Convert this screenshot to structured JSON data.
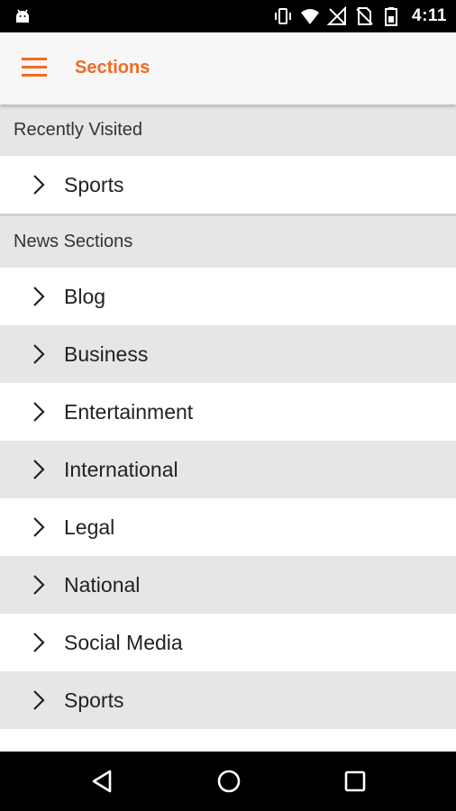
{
  "status_bar": {
    "time": "4:11",
    "icons": [
      "android-icon",
      "vibrate-icon",
      "wifi-icon",
      "no-signal-icon",
      "no-sim-icon",
      "battery-icon"
    ]
  },
  "app_bar": {
    "title": "Sections",
    "accent_color": "#f26a21"
  },
  "recently_visited": {
    "header": "Recently Visited",
    "items": [
      {
        "label": "Sports"
      }
    ]
  },
  "news_sections": {
    "header": "News Sections",
    "items": [
      {
        "label": "Blog"
      },
      {
        "label": "Business"
      },
      {
        "label": "Entertainment"
      },
      {
        "label": "International"
      },
      {
        "label": "Legal"
      },
      {
        "label": "National"
      },
      {
        "label": "Social Media"
      },
      {
        "label": "Sports"
      }
    ]
  },
  "nav_bar": {
    "buttons": [
      "back-icon",
      "home-icon",
      "recents-icon"
    ]
  }
}
